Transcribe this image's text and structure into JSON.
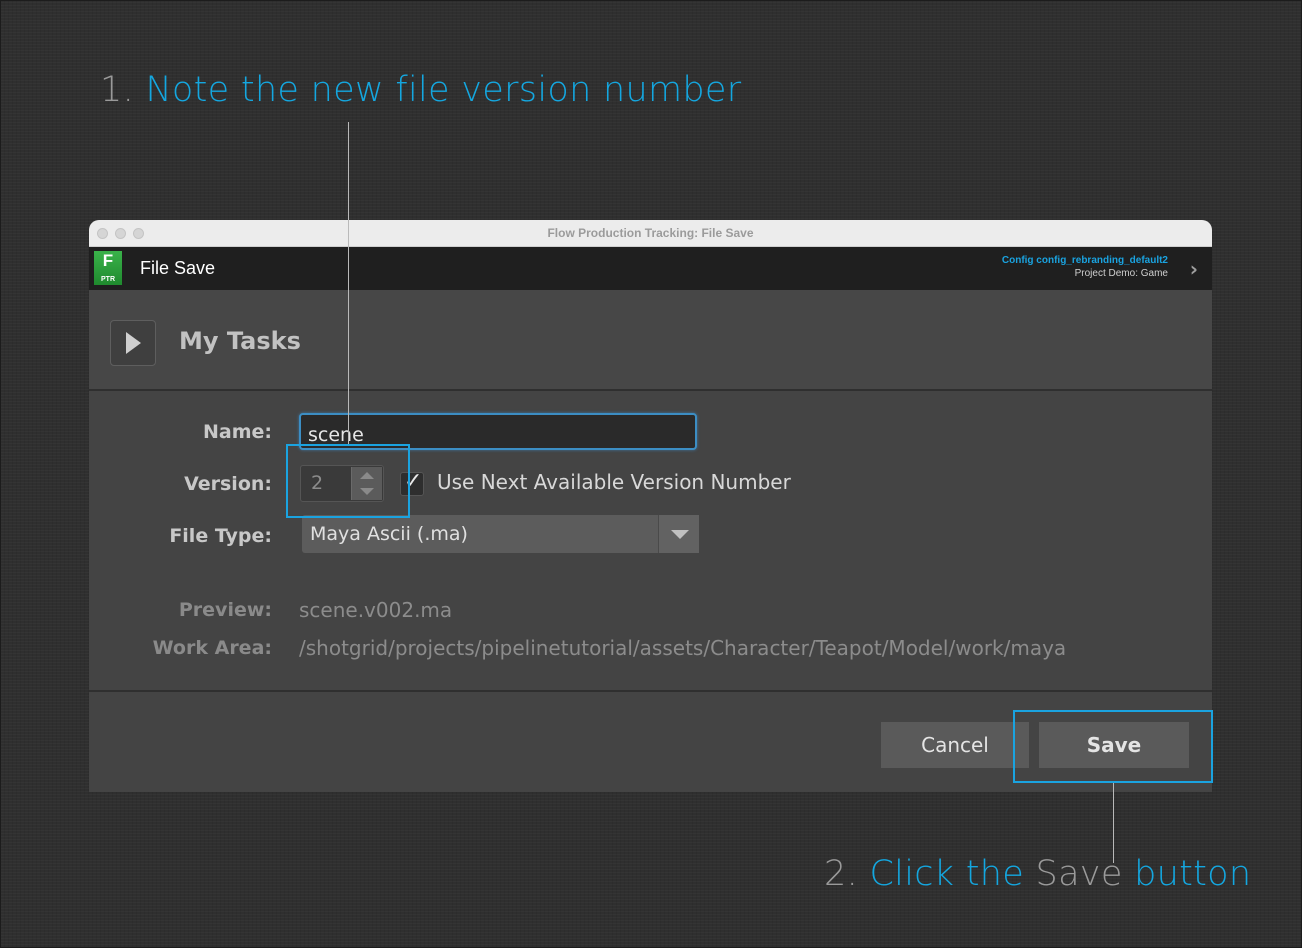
{
  "annotations": {
    "step1": {
      "num": "1.",
      "text": "Note the new file version number"
    },
    "step2": {
      "num": "2.",
      "text_a": "Click the",
      "text_b": "Save",
      "text_c": "button"
    }
  },
  "window": {
    "title": "Flow Production Tracking: File Save"
  },
  "header": {
    "logo_letter": "F",
    "logo_sub": "PTR",
    "app_title": "File Save",
    "config_name": "Config config_rebranding_default2",
    "project": "Project Demo: Game"
  },
  "tasks": {
    "label": "My Tasks"
  },
  "form": {
    "name_label": "Name:",
    "name_value": "scene",
    "version_label": "Version:",
    "version_value": "2",
    "use_next_label": "Use Next Available Version Number",
    "use_next_checked": true,
    "filetype_label": "File Type:",
    "filetype_value": "Maya Ascii (.ma)",
    "preview_label": "Preview:",
    "preview_value": "scene.v002.ma",
    "workarea_label": "Work Area:",
    "workarea_value": "/shotgrid/projects/pipelinetutorial/assets/Character/Teapot/Model/work/maya"
  },
  "buttons": {
    "cancel": "Cancel",
    "save": "Save"
  },
  "colors": {
    "accent": "#14a7e0",
    "highlight_box": "#1aa3e0",
    "config_text": "#1aa3e0"
  }
}
